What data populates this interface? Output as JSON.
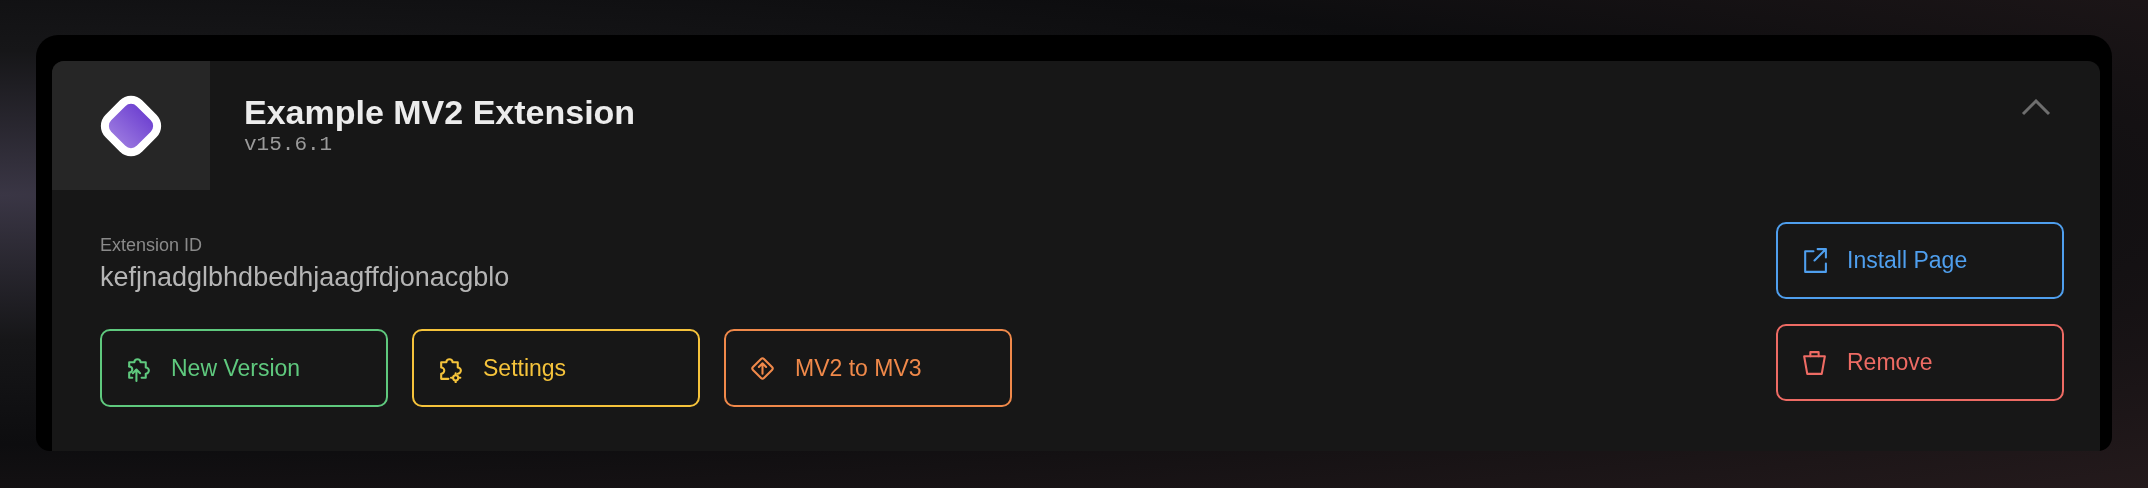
{
  "extension": {
    "name": "Example MV2 Extension",
    "version": "v15.6.1",
    "expanded": true,
    "id_label": "Extension ID",
    "id": "kefjnadglbhdbedhjaagffdjonacgblo"
  },
  "actions": [
    {
      "kind": "upload",
      "label": "New Version",
      "color": "#5fc97e"
    },
    {
      "kind": "settings",
      "label": "Settings",
      "color": "#f5c33b"
    },
    {
      "kind": "convert",
      "label": "MV2 to MV3",
      "color": "#f0894a"
    }
  ],
  "side_actions": [
    {
      "kind": "open",
      "label": "Install Page",
      "color": "#4f9fee"
    },
    {
      "kind": "remove",
      "label": "Remove",
      "color": "#ee6b64"
    }
  ]
}
